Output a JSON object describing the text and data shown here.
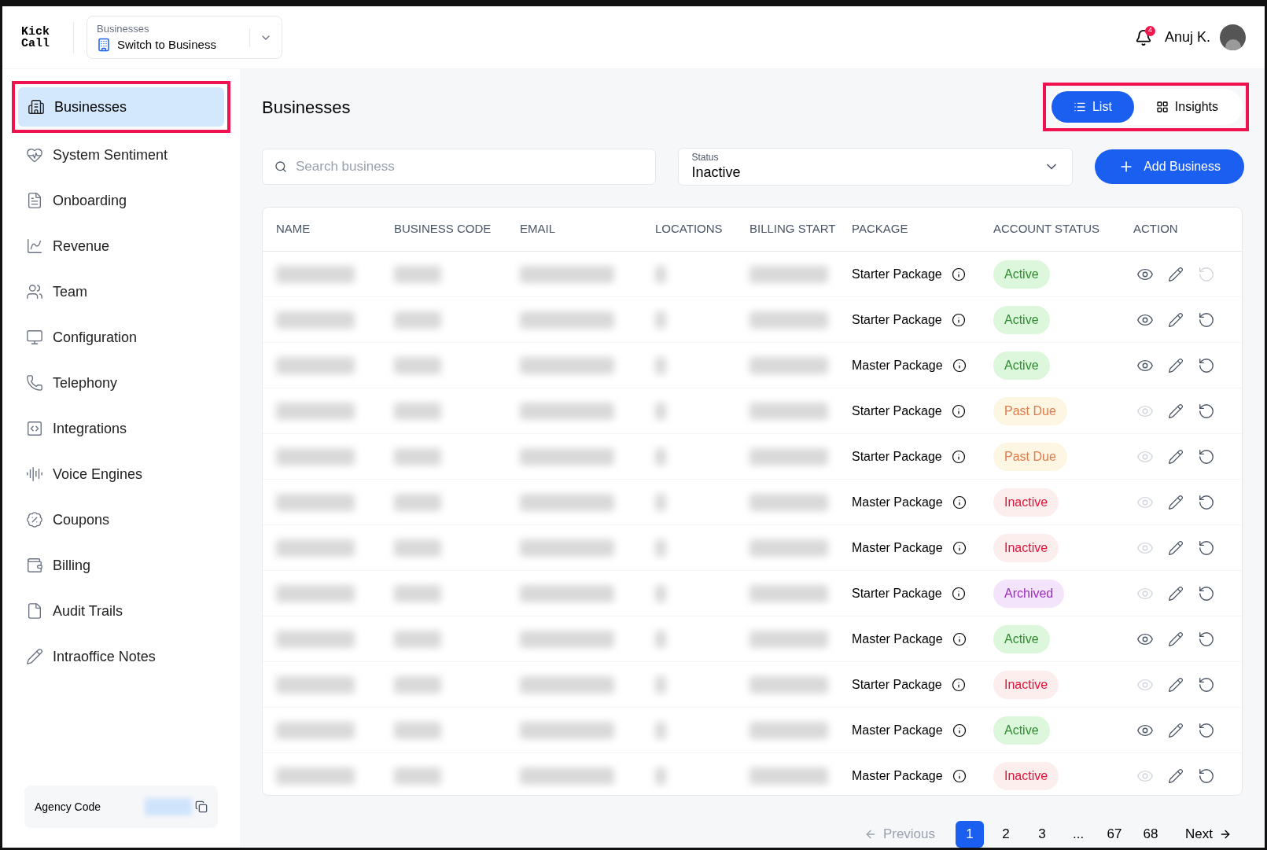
{
  "logo": "Kick\nCall",
  "switcher": {
    "label": "Businesses",
    "value": "Switch to Business"
  },
  "user": {
    "name": "Anuj K.",
    "notifications": "4"
  },
  "sidebar": {
    "items": [
      {
        "label": "Businesses",
        "selected": true
      },
      {
        "label": "System Sentiment",
        "selected": false
      },
      {
        "label": "Onboarding",
        "selected": false
      },
      {
        "label": "Revenue",
        "selected": false
      },
      {
        "label": "Team",
        "selected": false
      },
      {
        "label": "Configuration",
        "selected": false
      },
      {
        "label": "Telephony",
        "selected": false
      },
      {
        "label": "Integrations",
        "selected": false
      },
      {
        "label": "Voice Engines",
        "selected": false
      },
      {
        "label": "Coupons",
        "selected": false
      },
      {
        "label": "Billing",
        "selected": false
      },
      {
        "label": "Audit Trails",
        "selected": false
      },
      {
        "label": "Intraoffice Notes",
        "selected": false
      }
    ],
    "agency_code": {
      "label": "Agency Code"
    }
  },
  "page": {
    "title": "Businesses",
    "view_toggle": [
      {
        "label": "List",
        "selected": true
      },
      {
        "label": "Insights",
        "selected": false
      }
    ],
    "search": {
      "placeholder": "Search business"
    },
    "status_filter": {
      "label": "Status",
      "value": "Inactive"
    },
    "add_button": "Add Business"
  },
  "table": {
    "columns": [
      "NAME",
      "BUSINESS CODE",
      "EMAIL",
      "LOCATIONS",
      "BILLING START",
      "PACKAGE",
      "ACCOUNT STATUS",
      "ACTION"
    ],
    "rows": [
      {
        "package": "Starter Package",
        "status": "Active",
        "kind": "active",
        "view_enabled": true,
        "restore_enabled": false
      },
      {
        "package": "Starter Package",
        "status": "Active",
        "kind": "active",
        "view_enabled": true,
        "restore_enabled": true
      },
      {
        "package": "Master Package",
        "status": "Active",
        "kind": "active",
        "view_enabled": true,
        "restore_enabled": true
      },
      {
        "package": "Starter Package",
        "status": "Past Due",
        "kind": "pastdue",
        "view_enabled": false,
        "restore_enabled": true
      },
      {
        "package": "Starter Package",
        "status": "Past Due",
        "kind": "pastdue",
        "view_enabled": false,
        "restore_enabled": true
      },
      {
        "package": "Master Package",
        "status": "Inactive",
        "kind": "inactive",
        "view_enabled": false,
        "restore_enabled": true
      },
      {
        "package": "Master Package",
        "status": "Inactive",
        "kind": "inactive",
        "view_enabled": false,
        "restore_enabled": true
      },
      {
        "package": "Starter Package",
        "status": "Archived",
        "kind": "archived",
        "view_enabled": false,
        "restore_enabled": true
      },
      {
        "package": "Master Package",
        "status": "Active",
        "kind": "active",
        "view_enabled": true,
        "restore_enabled": true
      },
      {
        "package": "Starter Package",
        "status": "Inactive",
        "kind": "inactive",
        "view_enabled": false,
        "restore_enabled": true
      },
      {
        "package": "Master Package",
        "status": "Active",
        "kind": "active",
        "view_enabled": true,
        "restore_enabled": true
      },
      {
        "package": "Master Package",
        "status": "Inactive",
        "kind": "inactive",
        "view_enabled": false,
        "restore_enabled": true
      }
    ]
  },
  "pagination": {
    "previous": {
      "label": "Previous",
      "disabled": true
    },
    "pages": [
      {
        "label": "1",
        "selected": true
      },
      {
        "label": "2",
        "selected": false
      },
      {
        "label": "3",
        "selected": false
      },
      {
        "label": "...",
        "selected": false
      },
      {
        "label": "67",
        "selected": false
      },
      {
        "label": "68",
        "selected": false
      }
    ],
    "next": {
      "label": "Next",
      "disabled": false
    }
  }
}
